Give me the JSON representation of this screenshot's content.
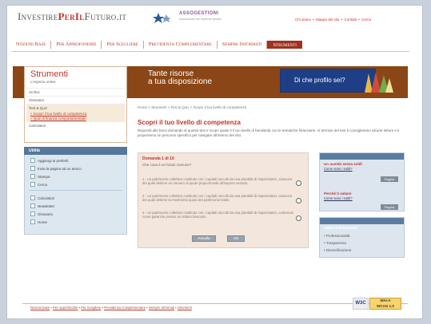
{
  "header": {
    "logo_part1": "Investire",
    "logo_part2": "PerIl",
    "logo_part3": "Futuro.it",
    "partner": "ASSOGESTIONI",
    "partner_sub": "associazione del risparmio gestito",
    "toplinks": [
      "Chi siamo",
      "Mappa del sito",
      "Contatti",
      "Cerca"
    ]
  },
  "nav": {
    "items": [
      "Nozioni Base",
      "Per Approfondire",
      "Per Scegliere",
      "Previdenza Complementare",
      "Sempre Informati",
      "Strumenti"
    ],
    "active_index": 5
  },
  "banner": {
    "line1": "Tante risorse",
    "line2": "a tua disposizione",
    "cta": "Di che profilo sei?"
  },
  "sidebar": {
    "title": "Strumenti",
    "subtitle": "L'esperto online",
    "items": [
      {
        "label": "Archivi"
      },
      {
        "label": "Glossario"
      },
      {
        "label": "Test & Quiz"
      },
      {
        "label": "» Scopri il tuo livello di competenza"
      },
      {
        "label": "» Quiz di finanza comportamentale"
      },
      {
        "label": "Calcolatori"
      }
    ]
  },
  "utilities": {
    "title": "Utilità",
    "group1": [
      "Aggiungi ai preferiti",
      "Invia la pagina ad un amico",
      "Stampa",
      "Cerca"
    ],
    "group2": [
      "Calcolatori",
      "Newsletter",
      "Glossario",
      "Home"
    ]
  },
  "main": {
    "breadcrumb": "Home > Strumenti > Test & Quiz > Scopri il tuo livello di competenza",
    "title": "Scopri il tuo livello di competenza",
    "intro": "Rispondi alle brevi domande di questo test e scopri quale è il tuo livello di familiarità con le tematiche finanziarie. Al termine del test ti consigleremo alcune letture e ti proporremo un percorso specifico per navigare all'interno del sito."
  },
  "quiz": {
    "question_num": "Domanda 1 di 10",
    "question": "Che cosa è un fondo comune?",
    "answers": [
      "1 - un patrimonio collettivo costituito con i capitali raccolti da una pluralità di risparmiatori, ciascuno dei quali detiene un numero di quote proporzionali all'importo versato.",
      "2 - un patrimonio collettivo costituito con i capitali raccolti da una pluralità di risparmiatori, ciascuno dei quali detiene la medesima quota del patrimonio totale.",
      "3 - un patrimonio collettivo costituito con i capitali raccolti da una pluralità di risparmiatori, contenuto come garanzie presso un istituto bancario."
    ],
    "cancel_label": "Annulla",
    "ok_label": "Ok"
  },
  "news": {
    "title": "Novità",
    "items": [
      {
        "title": "Un mondo senza soldi",
        "link": "Come sono i soldi?",
        "button": "Pagina"
      },
      {
        "title": "Perché ti salano",
        "link": "Come sono i soldi?",
        "button": "Pagina"
      }
    ]
  },
  "values": {
    "title": "Valori dell'industria",
    "items": [
      "• Professionalità",
      "• Trasparenza",
      "• Diversificazione"
    ]
  },
  "footer": {
    "links": [
      "Nozioni base",
      "Per Approfondire",
      "Per Scegliere",
      "Previdenza Complementare",
      "Sempre Informati",
      "Strumenti"
    ],
    "w3c": "W3C",
    "wai_line1": "WAI-A",
    "wai_line2": "WCAG 1.0"
  }
}
